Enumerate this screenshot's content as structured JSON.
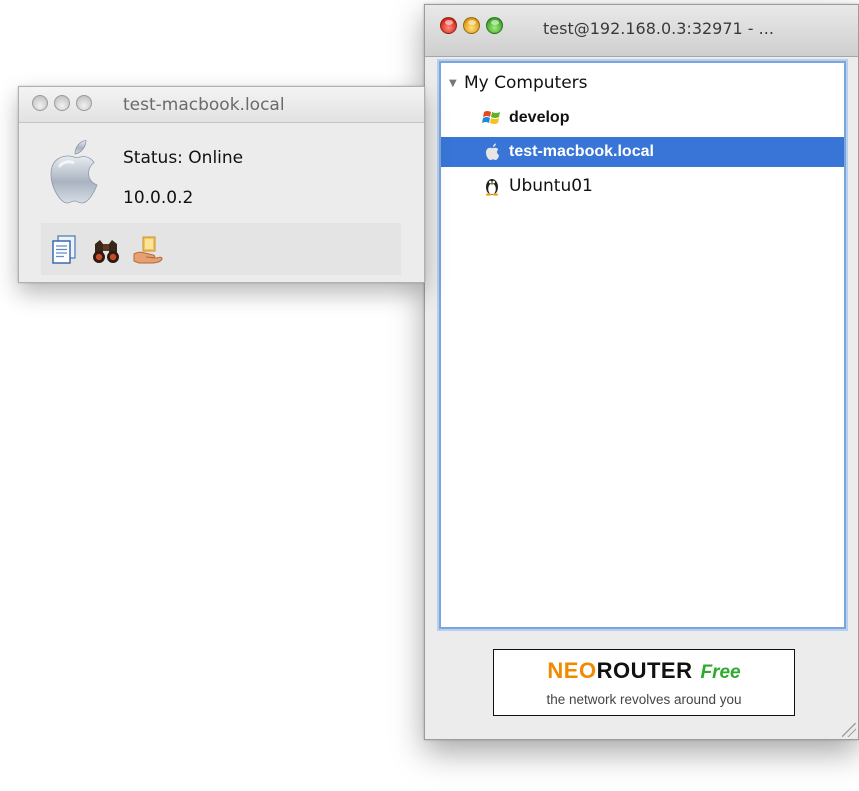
{
  "main_window": {
    "title": "test@192.168.0.3:32971 - ...",
    "tree": {
      "root_label": "My Computers",
      "items": [
        {
          "label": "develop",
          "icon": "windows-icon",
          "selected": false
        },
        {
          "label": "test-macbook.local",
          "icon": "apple-icon",
          "selected": true
        },
        {
          "label": "Ubuntu01",
          "icon": "linux-tux-icon",
          "selected": false
        }
      ]
    },
    "logo": {
      "neo": "NEO",
      "router": "ROUTER",
      "free": "Free",
      "tagline": "the network revolves around you"
    }
  },
  "detail_window": {
    "title": "test-macbook.local",
    "status": "Status: Online",
    "ip": "10.0.0.2",
    "actions": [
      "file-transfer-icon",
      "binoculars-icon",
      "shared-folder-icon"
    ]
  },
  "colors": {
    "selection": "#3875d7",
    "focus_ring": "#7aa6de",
    "logo_orange": "#f18a00",
    "logo_green": "#2eaa2e"
  }
}
